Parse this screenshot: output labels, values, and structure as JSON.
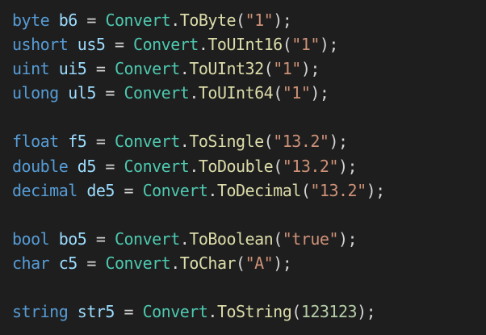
{
  "editor": {
    "language": "csharp",
    "colors": {
      "background": "#1e1e1e",
      "keyword": "#569cd6",
      "variable": "#9cdcfe",
      "class": "#4ec9b0",
      "method": "#dcdcaa",
      "string": "#ce9178",
      "number": "#b5cea8",
      "punctuation": "#d4d4d4"
    },
    "lines": [
      {
        "type": "byte",
        "name": "b6",
        "cls": "Convert",
        "method": "ToByte",
        "arg": "\"1\""
      },
      {
        "type": "ushort",
        "name": "us5",
        "cls": "Convert",
        "method": "ToUInt16",
        "arg": "\"1\""
      },
      {
        "type": "uint",
        "name": "ui5",
        "cls": "Convert",
        "method": "ToUInt32",
        "arg": "\"1\""
      },
      {
        "type": "ulong",
        "name": "ul5",
        "cls": "Convert",
        "method": "ToUInt64",
        "arg": "\"1\""
      },
      {
        "type": "float",
        "name": "f5",
        "cls": "Convert",
        "method": "ToSingle",
        "arg": "\"13.2\""
      },
      {
        "type": "double",
        "name": "d5",
        "cls": "Convert",
        "method": "ToDouble",
        "arg": "\"13.2\""
      },
      {
        "type": "decimal",
        "name": "de5",
        "cls": "Convert",
        "method": "ToDecimal",
        "arg": "\"13.2\""
      },
      {
        "type": "bool",
        "name": "bo5",
        "cls": "Convert",
        "method": "ToBoolean",
        "arg": "\"true\""
      },
      {
        "type": "char",
        "name": "c5",
        "cls": "Convert",
        "method": "ToChar",
        "arg": "\"A\""
      },
      {
        "type": "string",
        "name": "str5",
        "cls": "Convert",
        "method": "ToString",
        "arg": "123123"
      }
    ]
  }
}
